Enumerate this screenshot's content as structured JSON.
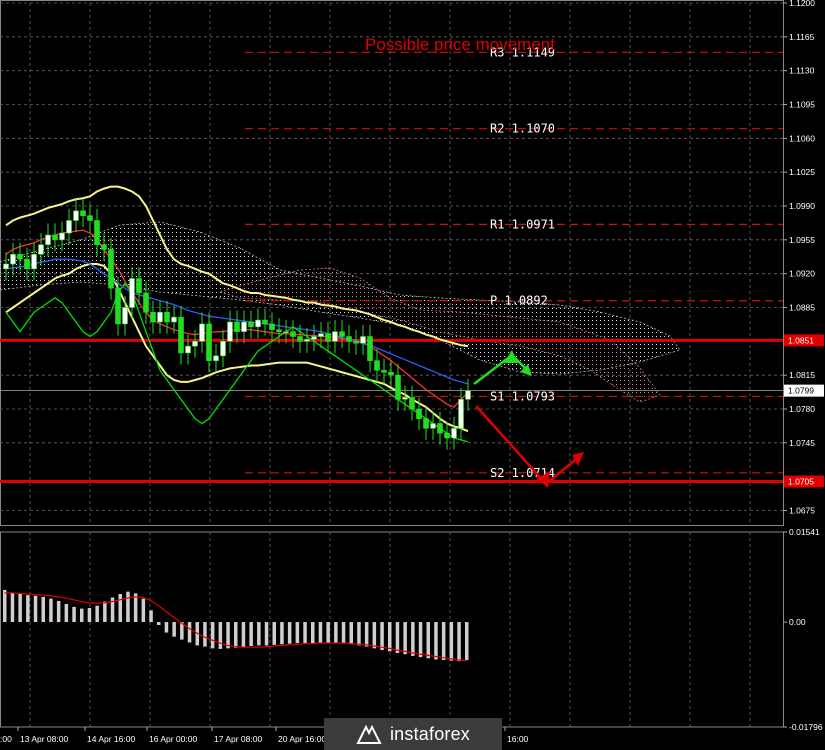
{
  "chart_data": [
    {
      "type": "line",
      "panel": "price",
      "title": "Possible price movement",
      "yrange": [
        1.066,
        1.12
      ],
      "y_ticks": [
        "1.1200",
        "1.1165",
        "1.1130",
        "1.1095",
        "1.1060",
        "1.1025",
        "1.0990",
        "1.0955",
        "1.0920",
        "1.0885",
        "1.0815",
        "1.0780",
        "1.0745",
        "1.0675"
      ],
      "current_price": "1.0799",
      "levels": [
        {
          "name": "R3",
          "value": "1.1149"
        },
        {
          "name": "R2",
          "value": "1.1070"
        },
        {
          "name": "R1",
          "value": "1.0971"
        },
        {
          "name": "P",
          "value": "1.0892"
        },
        {
          "name": "S1",
          "value": "1.0793"
        },
        {
          "name": "S2",
          "value": "1.0714"
        }
      ],
      "support_resistance": [
        {
          "value": "1.0851",
          "color": "#e00000"
        },
        {
          "value": "1.0705",
          "color": "#e00000"
        }
      ],
      "close": [
        1.093,
        1.094,
        1.0935,
        1.0925,
        1.094,
        1.095,
        1.096,
        1.0955,
        1.0962,
        1.0975,
        1.0985,
        1.098,
        1.0975,
        1.095,
        1.0945,
        1.0905,
        1.0868,
        1.0885,
        1.0915,
        1.09,
        1.088,
        1.087,
        1.088,
        1.087,
        1.0875,
        1.0838,
        1.0845,
        1.085,
        1.0868,
        1.083,
        1.0835,
        1.085,
        1.087,
        1.086,
        1.087,
        1.0865,
        1.0872,
        1.0868,
        1.0862,
        1.086,
        1.086,
        1.0855,
        1.085,
        1.0852,
        1.0855,
        1.0858,
        1.085,
        1.086,
        1.0855,
        1.085,
        1.0848,
        1.0855,
        1.083,
        1.082,
        1.0818,
        1.0815,
        1.079,
        1.0792,
        1.078,
        1.077,
        1.076,
        1.0765,
        1.0755,
        1.075,
        1.076,
        1.079,
        1.0799
      ],
      "series": [
        {
          "name": "",
          "color": "#f5f58a",
          "values": [
            1.097,
            1.0975,
            1.0978,
            1.098,
            1.0982,
            1.0985,
            1.0988,
            1.099,
            1.0992,
            1.0995,
            1.0997,
            1.0998,
            1.1,
            1.1005,
            1.1008,
            1.101,
            1.101,
            1.1008,
            1.1005,
            1.1,
            1.099,
            1.0975,
            1.096,
            1.0945,
            1.0935,
            1.093,
            1.0928,
            1.0925,
            1.0922,
            1.092,
            1.0915,
            1.091,
            1.0908,
            1.0905,
            1.0902,
            1.09,
            1.09,
            1.0898,
            1.0897,
            1.0896,
            1.0895,
            1.0893,
            1.0892,
            1.089,
            1.089,
            1.0888,
            1.0887,
            1.0886,
            1.0884,
            1.0883,
            1.0882,
            1.088,
            1.0878,
            1.0875,
            1.0872,
            1.087,
            1.0867,
            1.0865,
            1.0862,
            1.086,
            1.0857,
            1.0855,
            1.0852,
            1.085,
            1.0848,
            1.0846,
            1.0845
          ]
        },
        {
          "name": "",
          "color": "#f5f58a",
          "values": [
            1.088,
            1.0885,
            1.089,
            1.0895,
            1.09,
            1.0905,
            1.091,
            1.0915,
            1.0918,
            1.092,
            1.0925,
            1.0928,
            1.093,
            1.093,
            1.0928,
            1.092,
            1.0905,
            1.089,
            1.0875,
            1.086,
            1.0845,
            1.0835,
            1.0825,
            1.0815,
            1.081,
            1.0808,
            1.0808,
            1.081,
            1.0812,
            1.0815,
            1.0818,
            1.082,
            1.0822,
            1.0823,
            1.0824,
            1.0825,
            1.0825,
            1.0826,
            1.0827,
            1.0828,
            1.0828,
            1.0828,
            1.0828,
            1.0828,
            1.0826,
            1.0824,
            1.0822,
            1.082,
            1.0818,
            1.0816,
            1.0814,
            1.0812,
            1.081,
            1.0808,
            1.0806,
            1.0802,
            1.0798,
            1.0795,
            1.079,
            1.0786,
            1.0782,
            1.0776,
            1.077,
            1.0765,
            1.0762,
            1.076,
            1.0757
          ]
        },
        {
          "name": "",
          "color": "#ff3030",
          "values": [
            1.094,
            1.0945,
            1.0948,
            1.095,
            1.0952,
            1.0955,
            1.0958,
            1.096,
            1.0962,
            1.0963,
            1.0964,
            1.0965,
            1.0962,
            1.0955,
            1.0945,
            1.0935,
            1.0925,
            1.0912,
            1.09,
            1.089,
            1.088,
            1.0872,
            1.0868,
            1.0865,
            1.0862,
            1.086,
            1.0858,
            1.0857,
            1.0858,
            1.0859,
            1.086,
            1.086,
            1.0861,
            1.0862,
            1.0862,
            1.0862,
            1.0861,
            1.086,
            1.0859,
            1.0858,
            1.0858,
            1.0857,
            1.0857,
            1.0856,
            1.0856,
            1.0855,
            1.0855,
            1.0854,
            1.0853,
            1.0852,
            1.0851,
            1.0848,
            1.0845,
            1.084,
            1.0835,
            1.083,
            1.0824,
            1.0818,
            1.0812,
            1.0806,
            1.08,
            1.0795,
            1.079,
            1.0785,
            1.0782,
            1.079,
            1.0797
          ]
        },
        {
          "name": "",
          "color": "#2a5cff",
          "values": [
            1.0925,
            1.0926,
            1.0927,
            1.0928,
            1.093,
            1.0932,
            1.0933,
            1.0935,
            1.0935,
            1.0935,
            1.0934,
            1.0933,
            1.093,
            1.0925,
            1.092,
            1.0915,
            1.091,
            1.0905,
            1.09,
            1.0898,
            1.0896,
            1.0894,
            1.0892,
            1.089,
            1.0888,
            1.0885,
            1.0882,
            1.088,
            1.0878,
            1.0876,
            1.0875,
            1.0874,
            1.0873,
            1.0872,
            1.0871,
            1.087,
            1.0869,
            1.0868,
            1.0867,
            1.0866,
            1.0865,
            1.0864,
            1.0863,
            1.0862,
            1.0861,
            1.086,
            1.0858,
            1.0856,
            1.0854,
            1.0852,
            1.085,
            1.0848,
            1.0846,
            1.0843,
            1.084,
            1.0837,
            1.0834,
            1.0831,
            1.0828,
            1.0825,
            1.0822,
            1.0819,
            1.0816,
            1.0813,
            1.081,
            1.0808,
            1.0806
          ]
        },
        {
          "name": "",
          "color": "#00e000",
          "values": [
            1.088,
            1.087,
            1.086,
            1.087,
            1.088,
            1.0885,
            1.089,
            1.0895,
            1.089,
            1.088,
            1.087,
            1.086,
            1.0855,
            1.086,
            1.087,
            1.088,
            1.09,
            1.091,
            1.09,
            1.088,
            1.086,
            1.084,
            1.082,
            1.081,
            1.08,
            1.079,
            1.078,
            1.077,
            1.0765,
            1.077,
            1.078,
            1.079,
            1.08,
            1.081,
            1.082,
            1.083,
            1.084,
            1.0845,
            1.085,
            1.0855,
            1.086,
            1.0865,
            1.086,
            1.0855,
            1.085,
            1.0845,
            1.084,
            1.0835,
            1.083,
            1.0825,
            1.082,
            1.0815,
            1.081,
            1.0805,
            1.08,
            1.0795,
            1.079,
            1.0785,
            1.078,
            1.0775,
            1.077,
            1.0765,
            1.076,
            1.0755,
            1.075,
            1.0748,
            1.0746
          ]
        }
      ],
      "x_labels": [
        "13 Apr 08:00",
        "14 Apr 16:00",
        "16 Apr 00:00",
        "17 Apr 08:00",
        "20 Apr 16:00",
        "16:00"
      ],
      "x_label_start": ":00",
      "forecast_arrows": [
        {
          "direction": "up",
          "color": "#22dd22"
        },
        {
          "direction": "down-then-up",
          "color": "#e00000"
        }
      ]
    },
    {
      "type": "bar",
      "panel": "oscillator",
      "yrange": [
        -0.01796,
        0.01541
      ],
      "y_ticks": [
        "0.01541",
        "0.00",
        "-0.01796"
      ],
      "values": [
        0.0055,
        0.005,
        0.0048,
        0.0046,
        0.0045,
        0.0043,
        0.004,
        0.0036,
        0.0031,
        0.0026,
        0.0023,
        0.0024,
        0.0028,
        0.0035,
        0.0042,
        0.0048,
        0.0052,
        0.0049,
        0.004,
        0.002,
        -0.0005,
        -0.0018,
        -0.0025,
        -0.003,
        -0.0035,
        -0.004,
        -0.0042,
        -0.0045,
        -0.0046,
        -0.0045,
        -0.0044,
        -0.0043,
        -0.0041,
        -0.004,
        -0.004,
        -0.0039,
        -0.0038,
        -0.0037,
        -0.0036,
        -0.0036,
        -0.0036,
        -0.0035,
        -0.0035,
        -0.0036,
        -0.0037,
        -0.0038,
        -0.004,
        -0.0042,
        -0.0045,
        -0.0048,
        -0.005,
        -0.0053,
        -0.0055,
        -0.0058,
        -0.006,
        -0.0062,
        -0.0064,
        -0.0065,
        -0.0066,
        -0.0067,
        -0.0065
      ],
      "signal": [
        0.005,
        0.005,
        0.0049,
        0.0048,
        0.0047,
        0.0046,
        0.0045,
        0.0043,
        0.0041,
        0.0038,
        0.0035,
        0.0033,
        0.0032,
        0.0033,
        0.0035,
        0.0038,
        0.0041,
        0.0043,
        0.0042,
        0.0037,
        0.0028,
        0.0018,
        0.0008,
        -0.0002,
        -0.0011,
        -0.0019,
        -0.0026,
        -0.0031,
        -0.0036,
        -0.004,
        -0.0042,
        -0.0043,
        -0.0043,
        -0.0043,
        -0.0042,
        -0.0041,
        -0.004,
        -0.0039,
        -0.0038,
        -0.0037,
        -0.0037,
        -0.0036,
        -0.0036,
        -0.0036,
        -0.0036,
        -0.0037,
        -0.0038,
        -0.0039,
        -0.0041,
        -0.0043,
        -0.0045,
        -0.0048,
        -0.005,
        -0.0053,
        -0.0055,
        -0.0057,
        -0.0059,
        -0.0061,
        -0.0063,
        -0.0065,
        -0.0066
      ]
    }
  ],
  "brand": {
    "logo_text": "instaforex"
  }
}
